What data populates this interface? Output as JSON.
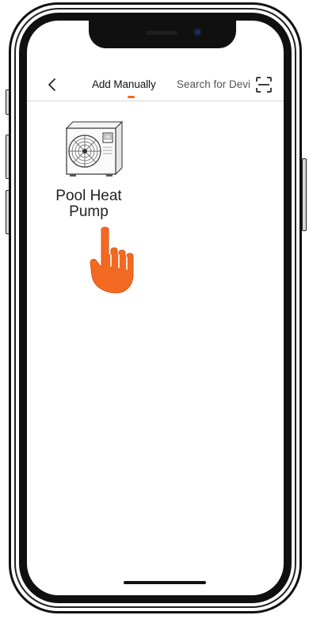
{
  "header": {
    "tabs": [
      {
        "label": "Add Manually",
        "active": true
      },
      {
        "label": "Search for Devi",
        "active": false
      }
    ]
  },
  "device_list": {
    "items": [
      {
        "label": "Pool Heat Pump",
        "icon": "heat-pump-unit-icon"
      }
    ]
  },
  "colors": {
    "accent": "#f26a21",
    "text": "#111111"
  },
  "icons": {
    "back": "chevron-left-icon",
    "scan": "scan-icon",
    "pointer": "hand-pointer-icon"
  }
}
